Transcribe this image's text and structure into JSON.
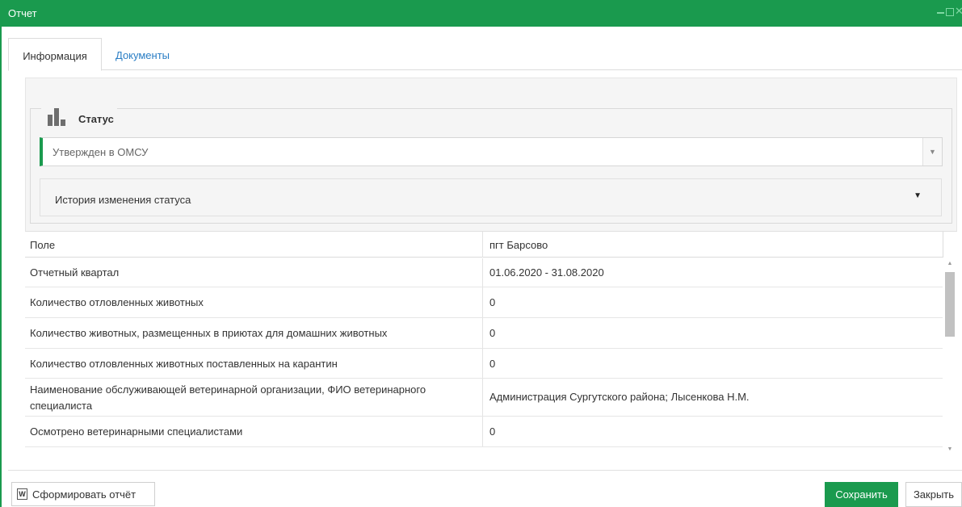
{
  "window": {
    "title": "Отчет"
  },
  "tabs": [
    {
      "label": "Информация",
      "active": true
    },
    {
      "label": "Документы",
      "active": false
    }
  ],
  "status": {
    "legend": "Статус",
    "selected": "Утвержден в ОМСУ",
    "history_label": "История изменения статуса"
  },
  "table": {
    "headers": [
      "Поле",
      "пгт Барсово"
    ],
    "rows": [
      {
        "field": "Отчетный квартал",
        "value": "01.06.2020 - 31.08.2020"
      },
      {
        "field": "Количество отловленных животных",
        "value": "0"
      },
      {
        "field": "Количество животных, размещенных в приютах для домашних животных",
        "value": "0"
      },
      {
        "field": "Количество отловленных животных поставленных на карантин",
        "value": "0"
      },
      {
        "field": "Наименование обслуживающей ветеринарной организации, ФИО ветеринарного специалиста",
        "value": "Администрация Сургутского района; Лысенкова Н.М."
      },
      {
        "field": "Осмотрено ветеринарными специалистами",
        "value": "0"
      }
    ]
  },
  "footer": {
    "report_button": "Сформировать отчёт",
    "save_button": "Сохранить",
    "close_button": "Закрыть"
  },
  "colors": {
    "accent": "#1a9a4e",
    "link": "#2a7ec5"
  }
}
